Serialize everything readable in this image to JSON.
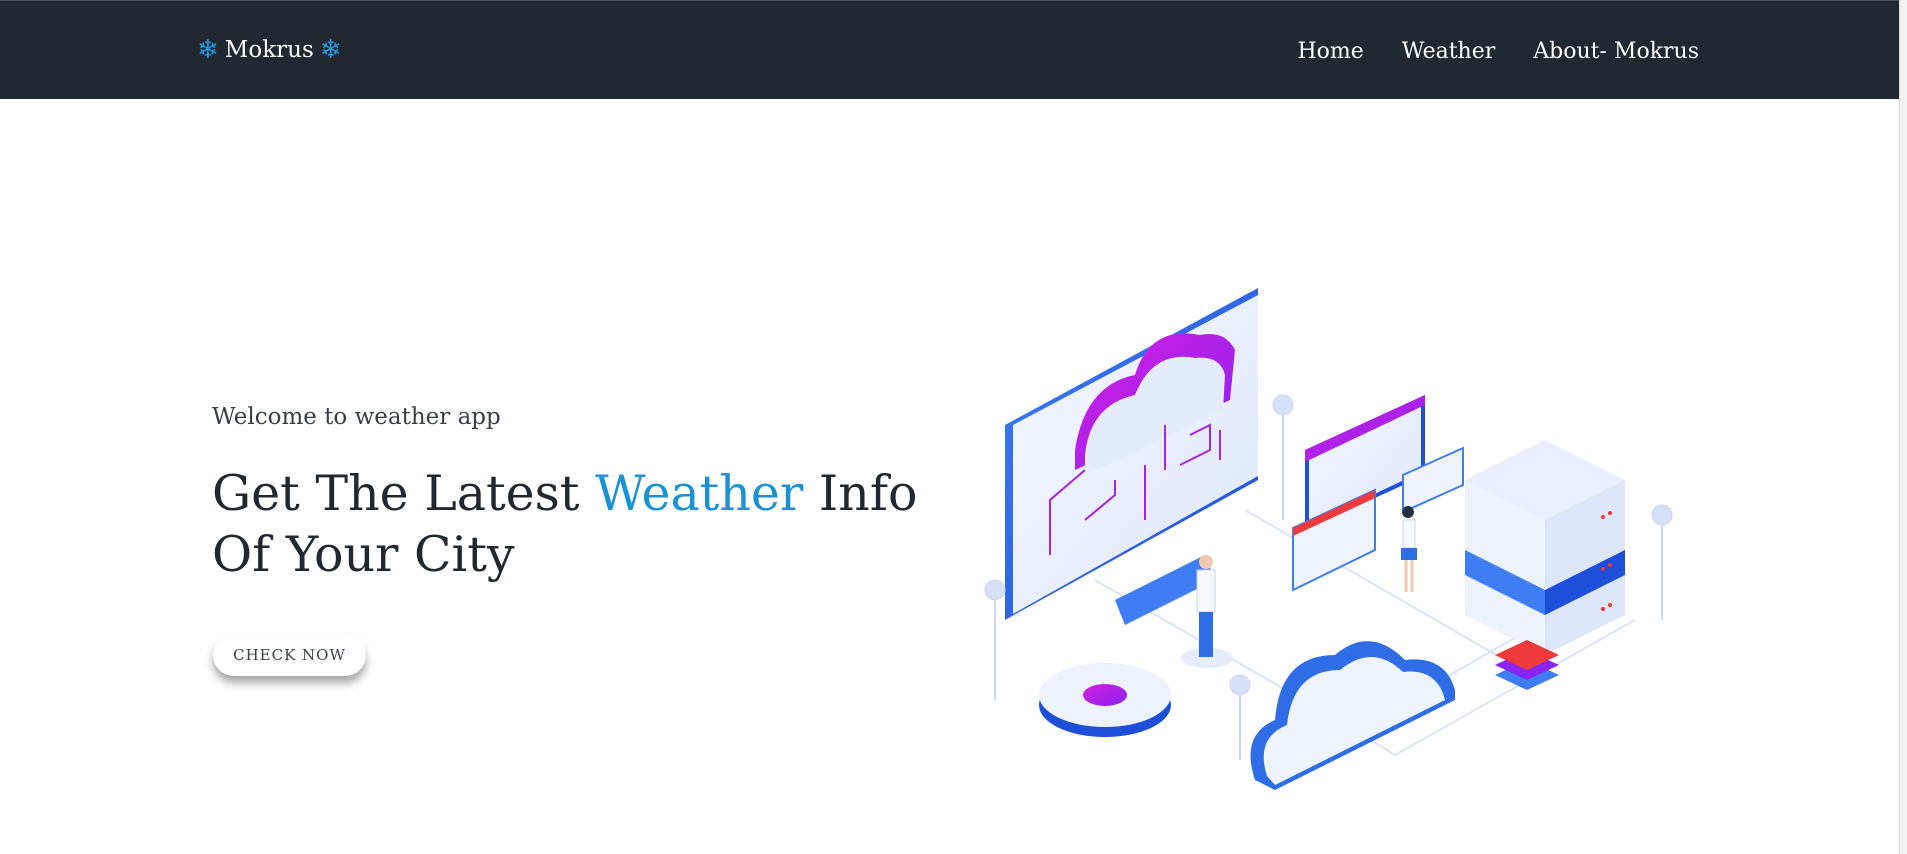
{
  "nav": {
    "brand": "Mokrus",
    "links": [
      "Home",
      "Weather",
      "About- Mokrus"
    ]
  },
  "hero": {
    "welcome": "Welcome to weather app",
    "headline_before": "Get The Latest",
    "headline_accent": "Weather",
    "headline_after": "Info Of Your City",
    "cta": "CHECK NOW"
  },
  "colors": {
    "navbar_bg": "#212830",
    "accent": "#1a92d6",
    "snowflake": "#1e9be8"
  },
  "icons": [
    "snowflake-icon"
  ]
}
